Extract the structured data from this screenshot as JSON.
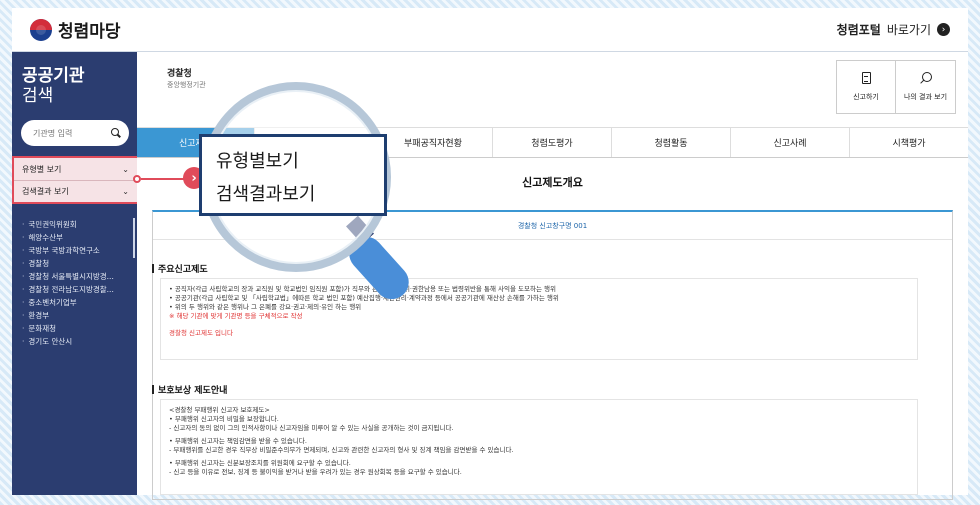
{
  "app": {
    "logo_text": "청렴마당",
    "portal_bold": "청렴포털",
    "portal_rest": "바로가기"
  },
  "sidebar": {
    "title_line1": "공공기관",
    "title_line2": "검색",
    "search_placeholder": "기관명 입력",
    "menu": [
      {
        "label": "유형별 보기"
      },
      {
        "label": "검색결과 보기"
      }
    ],
    "agencies": [
      "국민권익위원회",
      "해양수산부",
      "국방부 국방과학연구소",
      "경찰청",
      "경찰청 서울특별시지방경...",
      "경찰청 전라남도지방경찰...",
      "중소벤처기업부",
      "환경부",
      "문화재청",
      "경기도 안산시"
    ]
  },
  "header": {
    "title": "경찰청",
    "subtitle": "중앙행정기관",
    "buttons": [
      {
        "label": "신고하기",
        "icon": "document-icon"
      },
      {
        "label": "나의 결과 보기",
        "icon": "search-icon"
      }
    ]
  },
  "tabs": [
    "신고제도",
    "부패공직자현황",
    "청렴도평가",
    "청렴활동",
    "신고사례",
    "시책평가"
  ],
  "page": {
    "section_title": "신고제도개요",
    "box_head": "경찰청 신고창구명 001",
    "sub1": "주요신고제도",
    "box1": [
      "• 공직자(각급 사립학교의 장과 교직원 및 학교법인 임직원 포함)가 직무와 관련하여 지위·권한남용 또는 법령위반을 통해 사익을 도모하는 행위",
      "• 공공기관(각급 사립학교 및 「사립학교법」에따른 학교 법인 포함) 예산집행·재산관리·계약과정 등에서 공공기관에 재산상 손해를 가하는 행위",
      "• 위의 두 행위와 같은 행위나 그 은폐를 강요·권고·제의·유인 하는 행위"
    ],
    "box1_note": "※ 해당 기관에 맞게 기관명 등을 구체적으로 작성",
    "box1_note2": "경찰청 신고제도 입니다",
    "sub2": "보호보상 제도안내",
    "box2": [
      "<경찰청 부패행위 신고자 보호제도>",
      "• 부패행위 신고자의 비밀을 보장합니다.",
      "- 신고자의 동의 없이 그의 인적사항이나 신고자임을 미루어 알 수 있는 사실을 공개하는 것이 금지됩니다.",
      "• 부패행위 신고자는 책임감면을 받을 수 있습니다.",
      "- 부패행위를 신고한 경우 직무상 비밀준수의무가 면제되며, 신고와 관련한 신고자의 형사 및 징계 책임을 감면받을 수 있습니다.",
      "• 부패행위 신고자는 신분보장조치를 위원회에 요구할 수 있습니다.",
      "- 신고 등을 이유로 전보, 징계 등 불이익을 받거나 받을 우려가 있는 경우 원상회복 등을 요구할 수 있습니다."
    ]
  },
  "callout": {
    "line1": "유형별보기",
    "line2": "검색결과보기"
  },
  "colors": {
    "sidebar": "#2b3d70",
    "accent": "#3b97d3",
    "highlight": "#e04b5a"
  }
}
